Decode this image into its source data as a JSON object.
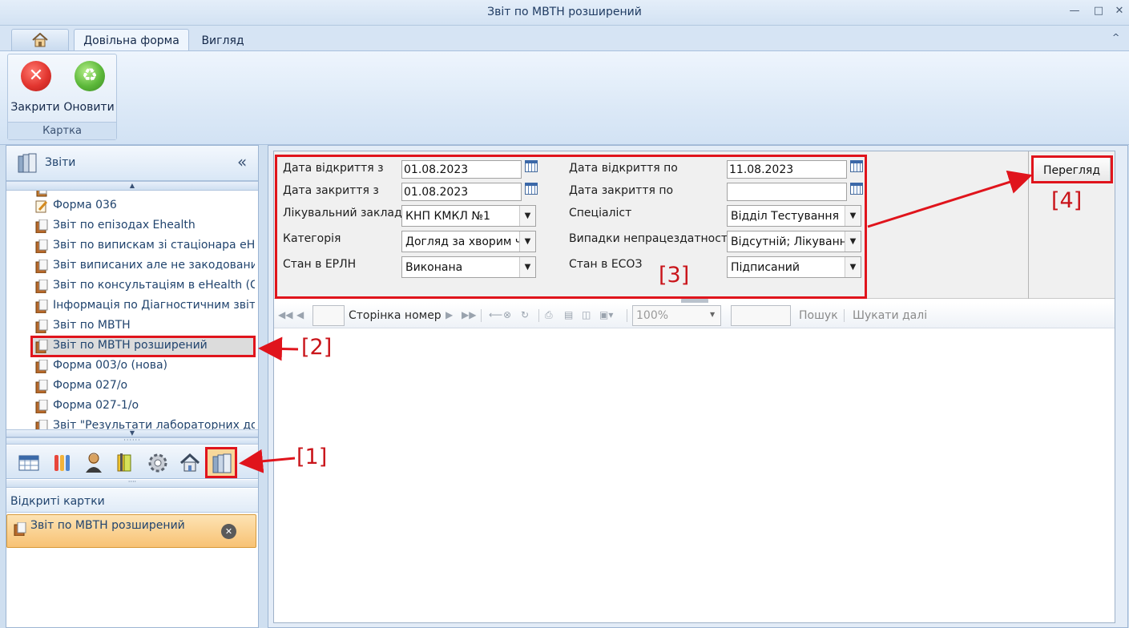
{
  "window": {
    "title": "Звіт по МВТН розширений"
  },
  "ribbon": {
    "tabs": [
      {
        "label": "Довільна форма"
      },
      {
        "label": "Вигляд"
      }
    ],
    "group_label": "Картка",
    "buttons": {
      "close": "Закрити",
      "refresh": "Оновити"
    }
  },
  "left_panel": {
    "header_title": "Звіти",
    "collapse_glyph": "«",
    "tree_items": [
      {
        "label": "Форма 036",
        "kind": "form"
      },
      {
        "label": "Звіт по епізодах Ehealth",
        "kind": "report"
      },
      {
        "label": "Звіт по випискам зі стаціонара eHea",
        "kind": "report"
      },
      {
        "label": "Звіт виписаних але не закодованих і",
        "kind": "report"
      },
      {
        "label": "Звіт по консультаціям в eHealth (СМ",
        "kind": "report"
      },
      {
        "label": "Інформація по Діагностичним звітам",
        "kind": "report"
      },
      {
        "label": "Звіт по МВТН",
        "kind": "report"
      },
      {
        "label": "Звіт по МВТН розширений",
        "kind": "report",
        "selected": true
      },
      {
        "label": "Форма 003/о (нова)",
        "kind": "report"
      },
      {
        "label": "Форма 027/о",
        "kind": "report"
      },
      {
        "label": "Форма 027-1/о",
        "kind": "report"
      },
      {
        "label": "Звіт \"Результати лабораторних досл",
        "kind": "report"
      }
    ],
    "open_cards_title": "Відкриті картки",
    "open_cards": [
      {
        "label": "Звіт по МВТН розширений"
      }
    ]
  },
  "params": {
    "date_open_from": {
      "label": "Дата відкриття з",
      "value": "01.08.2023"
    },
    "date_open_to": {
      "label": "Дата відкриття по",
      "value": "11.08.2023"
    },
    "date_close_from": {
      "label": "Дата закриття з",
      "value": "01.08.2023"
    },
    "date_close_to": {
      "label": "Дата закриття по",
      "value": ""
    },
    "facility": {
      "label": "Лікувальний заклад",
      "value": "КНП КМКЛ №1"
    },
    "specialist": {
      "label": "Спеціаліст",
      "value": "Відділ Тестування"
    },
    "category": {
      "label": "Категорія",
      "value": "Догляд за хворим чл"
    },
    "disability_cases": {
      "label": "Випадки непрацездатності",
      "value": "Відсутній; Лікування"
    },
    "erln_state": {
      "label": "Стан в ЕРЛН",
      "value": "Виконана"
    },
    "esoz_state": {
      "label": "Стан в ЕСОЗ",
      "value": "Підписаний"
    },
    "preview_button": "Перегляд"
  },
  "viewer_toolbar": {
    "page_label": "Сторінка номер",
    "zoom": "100%",
    "search_label": "Пошук",
    "search_next": "Шукати далі"
  },
  "annotations": [
    "[1]",
    "[2]",
    "[3]",
    "[4]"
  ],
  "colors": {
    "annotation": "#e0141c",
    "close_button": "#e2352f",
    "refresh_button": "#5cb83a"
  }
}
